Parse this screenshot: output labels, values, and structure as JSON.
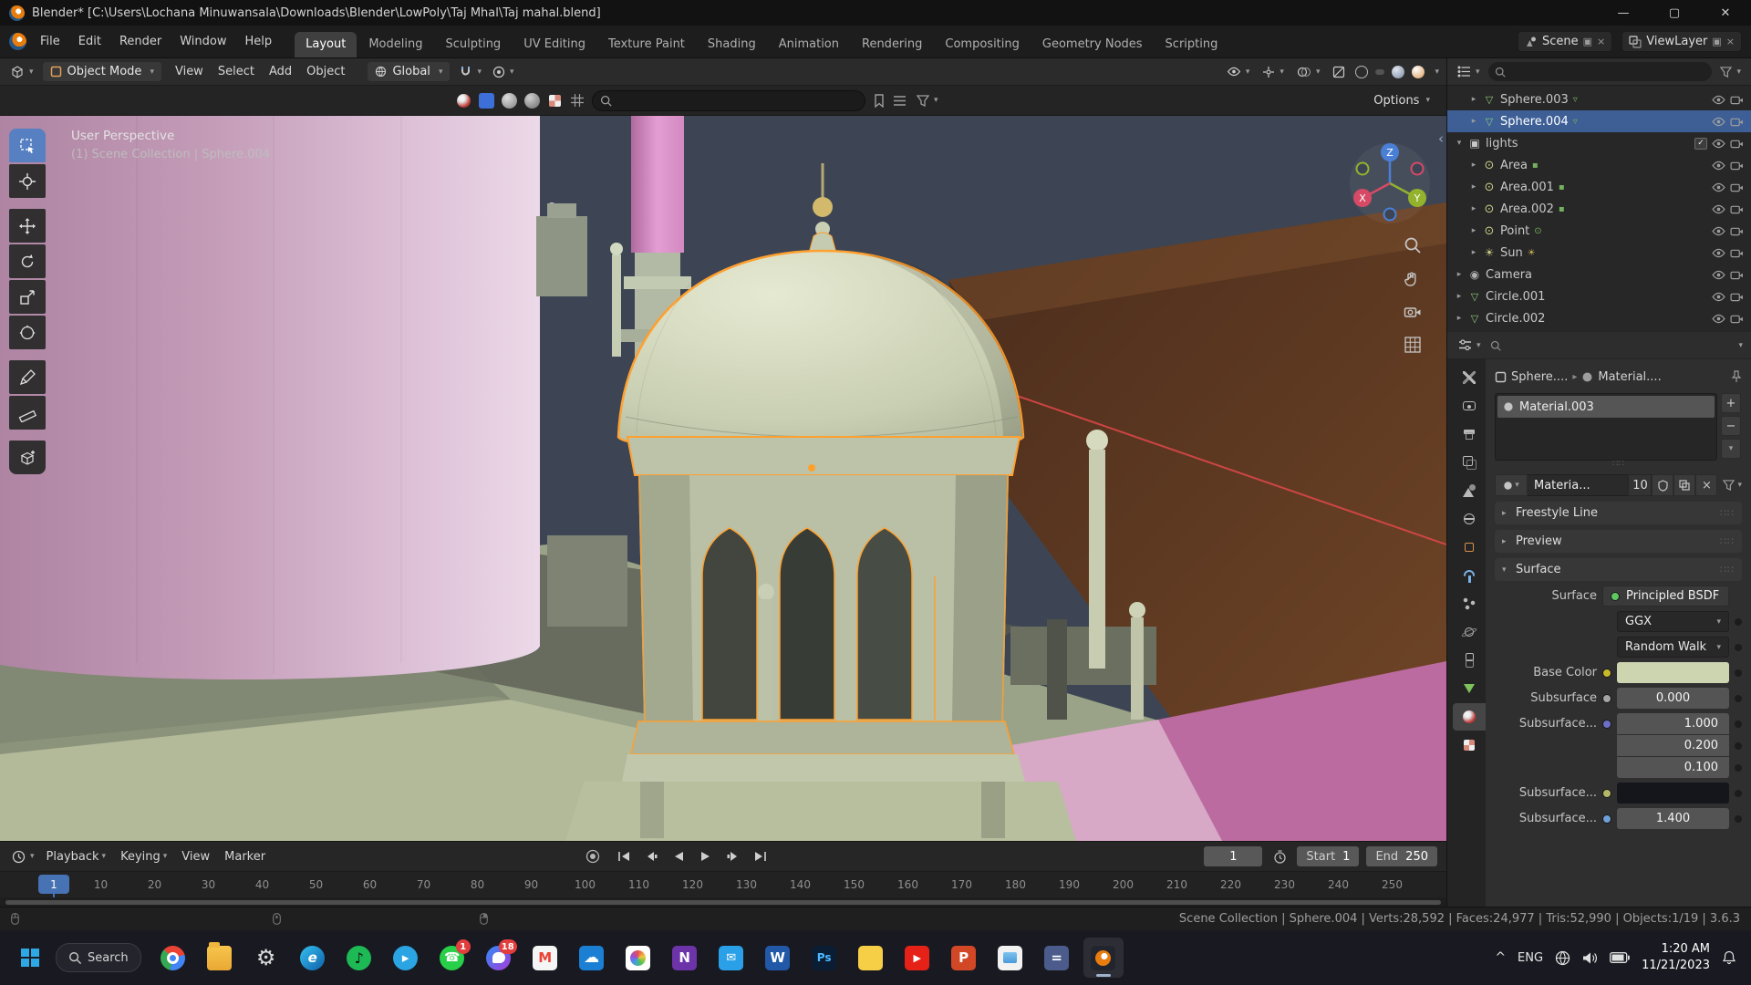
{
  "window": {
    "title": "Blender* [C:\\Users\\Lochana Minuwansala\\Downloads\\Blender\\LowPoly\\Taj Mhal\\Taj mahal.blend]"
  },
  "menu_bar": {
    "menus": [
      "File",
      "Edit",
      "Render",
      "Window",
      "Help"
    ],
    "workspaces": [
      {
        "label": "Layout",
        "cls": "active"
      },
      {
        "label": "Modeling"
      },
      {
        "label": "Sculpting"
      },
      {
        "label": "UV Editing"
      },
      {
        "label": "Texture Paint"
      },
      {
        "label": "Shading"
      },
      {
        "label": "Animation"
      },
      {
        "label": "Rendering"
      },
      {
        "label": "Compositing"
      },
      {
        "label": "Geometry Nodes"
      },
      {
        "label": "Scripting"
      }
    ],
    "scene": "Scene",
    "view_layer": "ViewLayer"
  },
  "viewport_header": {
    "mode": "Object Mode",
    "menus": [
      "View",
      "Select",
      "Add",
      "Object"
    ],
    "orientation": "Global",
    "options": "Options"
  },
  "viewport": {
    "perspective": "User Perspective",
    "collection_info": "(1) Scene Collection | Sphere.004",
    "axis_x": "X",
    "axis_y": "Y",
    "axis_z": "Z"
  },
  "toolbar_tools": [
    "box-select",
    "cursor",
    "move",
    "rotate",
    "scale",
    "transform",
    "annotate",
    "measure",
    "add-cube"
  ],
  "outliner": {
    "items": [
      {
        "label": "Sphere.003",
        "arrow": "▸",
        "cls": "ind-2 ic-mesh has-data"
      },
      {
        "label": "Sphere.004",
        "arrow": "▸",
        "cls": "ind-2 ic-mesh has-data selected"
      },
      {
        "label": "lights",
        "arrow": "▾",
        "cls": "ind-1 ic-collection has-check"
      },
      {
        "label": "Area",
        "arrow": "▸",
        "cls": "ind-2 ic-light has-nodes"
      },
      {
        "label": "Area.001",
        "arrow": "▸",
        "cls": "ind-2 ic-light has-nodes"
      },
      {
        "label": "Area.002",
        "arrow": "▸",
        "cls": "ind-2 ic-light has-nodes"
      },
      {
        "label": "Point",
        "arrow": "▸",
        "cls": "ind-2 ic-light has-dot"
      },
      {
        "label": "Sun",
        "arrow": "▸",
        "cls": "ind-2 ic-sun has-sun"
      },
      {
        "label": "Camera",
        "arrow": "▸",
        "cls": "ind-1 ic-camera"
      },
      {
        "label": "Circle.001",
        "arrow": "▸",
        "cls": "ind-1 ic-mesh"
      },
      {
        "label": "Circle.002",
        "arrow": "▸",
        "cls": "ind-1 ic-mesh"
      }
    ]
  },
  "properties": {
    "tabs": [
      "tool",
      "render",
      "output",
      "view-layer",
      "scene",
      "world",
      "object",
      "modifiers",
      "particles",
      "physics",
      "constraints",
      "object-data",
      "material",
      "texture"
    ],
    "breadcrumb_object": "Sphere....",
    "breadcrumb_material": "Material....",
    "slot": "Material.003",
    "slot_add": "+",
    "slot_remove": "−",
    "material_name": "Materia...",
    "material_users": "10",
    "unlink": "×",
    "panel_freestyle": "Freestyle Line",
    "panel_preview": "Preview",
    "panel_surface": "Surface",
    "surface": {
      "surface_label": "Surface",
      "bsdf": "Principled BSDF",
      "distribution": "GGX",
      "method": "Random Walk",
      "base_color_label": "Base Color",
      "base_color": "#ccd5b0",
      "subsurface_label": "Subsurface",
      "subsurface_value": "0.000",
      "radius_label": "Subsurface...",
      "radius_values": [
        "1.000",
        "0.200",
        "0.100"
      ],
      "sss_color_label": "Subsurface...",
      "sss_color": "#14161c",
      "ior_label": "Subsurface...",
      "ior_value": "1.400"
    }
  },
  "timeline": {
    "menus": [
      {
        "label": "Playback",
        "cls": "has-caret"
      },
      {
        "label": "Keying",
        "cls": "has-caret"
      },
      {
        "label": "View"
      },
      {
        "label": "Marker"
      }
    ],
    "current_frame": "1",
    "playhead": "1",
    "start_label": "Start",
    "start_value": "1",
    "end_label": "End",
    "end_value": "250",
    "ticks": [
      "10",
      "20",
      "30",
      "40",
      "50",
      "60",
      "70",
      "80",
      "90",
      "100",
      "110",
      "120",
      "130",
      "140",
      "150",
      "160",
      "170",
      "180",
      "190",
      "200",
      "210",
      "220",
      "230",
      "240",
      "250"
    ]
  },
  "status_bar": {
    "info": "Scene Collection | Sphere.004 | Verts:28,592 | Faces:24,977 | Tris:52,990 | Objects:1/19 | 3.6.3"
  },
  "taskbar": {
    "search": "Search",
    "apps": [
      {
        "name": "chrome",
        "cls": "app-chrome"
      },
      {
        "name": "file-explorer",
        "cls": "app-folder"
      },
      {
        "name": "settings",
        "cls": "app-settings",
        "glyph": "⚙"
      },
      {
        "name": "edge",
        "cls": "app-edge",
        "glyph": "e"
      },
      {
        "name": "spotify",
        "cls": "app-spotify",
        "glyph": "♪"
      },
      {
        "name": "telegram",
        "cls": "app-telegram",
        "glyph": "▸"
      },
      {
        "name": "whatsapp",
        "cls": "app-whatsapp",
        "glyph": "☎",
        "badge": "1"
      },
      {
        "name": "messenger",
        "cls": "app-messenger",
        "badge": "18"
      },
      {
        "name": "gmail",
        "cls": "app-gmail",
        "glyph": "M"
      },
      {
        "name": "onedrive",
        "cls": "app-onedrive",
        "glyph": "☁"
      },
      {
        "name": "photos",
        "cls": "app-photos"
      },
      {
        "name": "onenote",
        "cls": "app-onenote",
        "glyph": "N"
      },
      {
        "name": "mail",
        "cls": "app-mail",
        "glyph": "✉"
      },
      {
        "name": "word",
        "cls": "app-word",
        "glyph": "W"
      },
      {
        "name": "photoshop",
        "cls": "app-photoshop",
        "glyph": "Ps"
      },
      {
        "name": "sticky-notes",
        "cls": "app-notes"
      },
      {
        "name": "youtube",
        "cls": "app-youtube",
        "glyph": "▶"
      },
      {
        "name": "powerpoint",
        "cls": "app-powerpoint",
        "glyph": "P"
      },
      {
        "name": "gallery",
        "cls": "app-gallery"
      },
      {
        "name": "calculator",
        "cls": "app-calculator",
        "glyph": "="
      },
      {
        "name": "blender",
        "cls": "app-blender active"
      }
    ],
    "tray": {
      "chevron": "^",
      "lang": "ENG",
      "time": "1:20 AM",
      "date": "11/21/2023"
    }
  }
}
